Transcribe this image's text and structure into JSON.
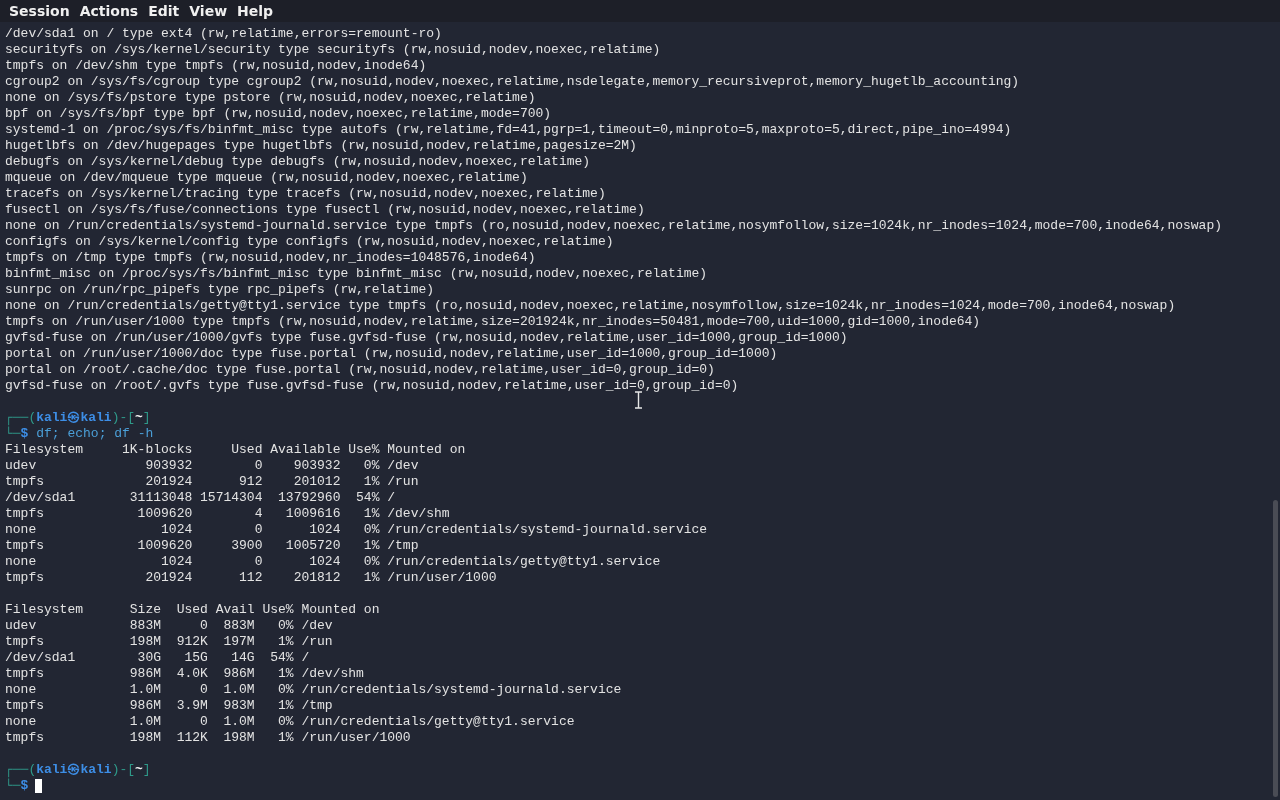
{
  "menu": [
    "Session",
    "Actions",
    "Edit",
    "View",
    "Help"
  ],
  "blocks": [
    {
      "kind": "output",
      "lines": [
        "/dev/sda1 on / type ext4 (rw,relatime,errors=remount-ro)",
        "securityfs on /sys/kernel/security type securityfs (rw,nosuid,nodev,noexec,relatime)",
        "tmpfs on /dev/shm type tmpfs (rw,nosuid,nodev,inode64)",
        "cgroup2 on /sys/fs/cgroup type cgroup2 (rw,nosuid,nodev,noexec,relatime,nsdelegate,memory_recursiveprot,memory_hugetlb_accounting)",
        "none on /sys/fs/pstore type pstore (rw,nosuid,nodev,noexec,relatime)",
        "bpf on /sys/fs/bpf type bpf (rw,nosuid,nodev,noexec,relatime,mode=700)",
        "systemd-1 on /proc/sys/fs/binfmt_misc type autofs (rw,relatime,fd=41,pgrp=1,timeout=0,minproto=5,maxproto=5,direct,pipe_ino=4994)",
        "hugetlbfs on /dev/hugepages type hugetlbfs (rw,nosuid,nodev,relatime,pagesize=2M)",
        "debugfs on /sys/kernel/debug type debugfs (rw,nosuid,nodev,noexec,relatime)",
        "mqueue on /dev/mqueue type mqueue (rw,nosuid,nodev,noexec,relatime)",
        "tracefs on /sys/kernel/tracing type tracefs (rw,nosuid,nodev,noexec,relatime)",
        "fusectl on /sys/fs/fuse/connections type fusectl (rw,nosuid,nodev,noexec,relatime)",
        "none on /run/credentials/systemd-journald.service type tmpfs (ro,nosuid,nodev,noexec,relatime,nosymfollow,size=1024k,nr_inodes=1024,mode=700,inode64,noswap)",
        "configfs on /sys/kernel/config type configfs (rw,nosuid,nodev,noexec,relatime)",
        "tmpfs on /tmp type tmpfs (rw,nosuid,nodev,nr_inodes=1048576,inode64)",
        "binfmt_misc on /proc/sys/fs/binfmt_misc type binfmt_misc (rw,nosuid,nodev,noexec,relatime)",
        "sunrpc on /run/rpc_pipefs type rpc_pipefs (rw,relatime)",
        "none on /run/credentials/getty@tty1.service type tmpfs (ro,nosuid,nodev,noexec,relatime,nosymfollow,size=1024k,nr_inodes=1024,mode=700,inode64,noswap)",
        "tmpfs on /run/user/1000 type tmpfs (rw,nosuid,nodev,relatime,size=201924k,nr_inodes=50481,mode=700,uid=1000,gid=1000,inode64)",
        "gvfsd-fuse on /run/user/1000/gvfs type fuse.gvfsd-fuse (rw,nosuid,nodev,relatime,user_id=1000,group_id=1000)",
        "portal on /run/user/1000/doc type fuse.portal (rw,nosuid,nodev,relatime,user_id=1000,group_id=1000)",
        "portal on /root/.cache/doc type fuse.portal (rw,nosuid,nodev,relatime,user_id=0,group_id=0)",
        "gvfsd-fuse on /root/.gvfs type fuse.gvfsd-fuse (rw,nosuid,nodev,relatime,user_id=0,group_id=0)"
      ]
    },
    {
      "kind": "blank"
    },
    {
      "kind": "prompt",
      "open": "┌──(",
      "user": "kali",
      "at": "㉿",
      "host": "kali",
      "mid": ")-[",
      "dir": "~",
      "close": "]",
      "corner": "└─",
      "sign": "$",
      "command": "df; echo; df -h",
      "cursor": false
    },
    {
      "kind": "output",
      "lines": [
        "Filesystem     1K-blocks     Used Available Use% Mounted on",
        "udev              903932        0    903932   0% /dev",
        "tmpfs             201924      912    201012   1% /run",
        "/dev/sda1       31113048 15714304  13792960  54% /",
        "tmpfs            1009620        4   1009616   1% /dev/shm",
        "none                1024        0      1024   0% /run/credentials/systemd-journald.service",
        "tmpfs            1009620     3900   1005720   1% /tmp",
        "none                1024        0      1024   0% /run/credentials/getty@tty1.service",
        "tmpfs             201924      112    201812   1% /run/user/1000"
      ]
    },
    {
      "kind": "blank"
    },
    {
      "kind": "output",
      "lines": [
        "Filesystem      Size  Used Avail Use% Mounted on",
        "udev            883M     0  883M   0% /dev",
        "tmpfs           198M  912K  197M   1% /run",
        "/dev/sda1        30G   15G   14G  54% /",
        "tmpfs           986M  4.0K  986M   1% /dev/shm",
        "none            1.0M     0  1.0M   0% /run/credentials/systemd-journald.service",
        "tmpfs           986M  3.9M  983M   1% /tmp",
        "none            1.0M     0  1.0M   0% /run/credentials/getty@tty1.service",
        "tmpfs           198M  112K  198M   1% /run/user/1000"
      ]
    },
    {
      "kind": "blank"
    },
    {
      "kind": "prompt",
      "open": "┌──(",
      "user": "kali",
      "at": "㉿",
      "host": "kali",
      "mid": ")-[",
      "dir": "~",
      "close": "]",
      "corner": "└─",
      "sign": "$",
      "cursor": true
    }
  ]
}
